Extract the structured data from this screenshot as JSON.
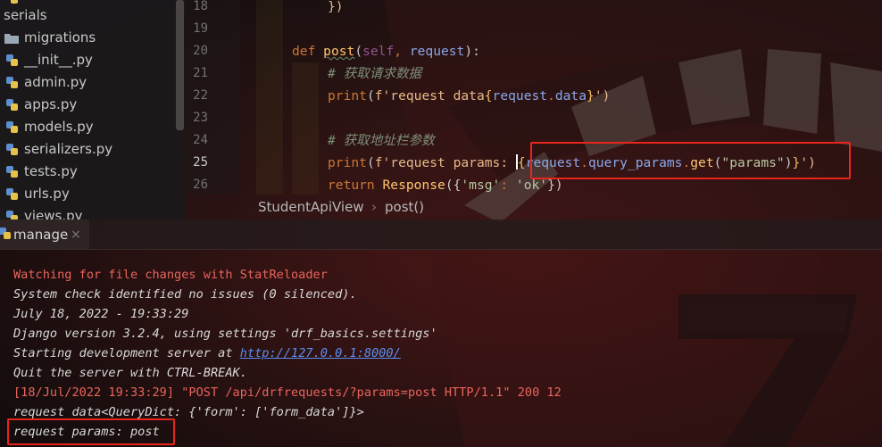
{
  "project_tree": {
    "items": [
      {
        "label": "",
        "kind": "python"
      },
      {
        "label": "serials",
        "kind": "package"
      },
      {
        "label": "migrations",
        "kind": "folder"
      },
      {
        "label": "__init__.py",
        "kind": "python"
      },
      {
        "label": "admin.py",
        "kind": "python"
      },
      {
        "label": "apps.py",
        "kind": "python"
      },
      {
        "label": "models.py",
        "kind": "python"
      },
      {
        "label": "serializers.py",
        "kind": "python"
      },
      {
        "label": "tests.py",
        "kind": "python"
      },
      {
        "label": "urls.py",
        "kind": "python"
      },
      {
        "label": "views.py",
        "kind": "python"
      }
    ]
  },
  "editor": {
    "line_numbers": [
      "18",
      "19",
      "20",
      "21",
      "22",
      "23",
      "24",
      "25",
      "26"
    ],
    "code": {
      "l18_close": "})",
      "l20_def": "def",
      "l20_name": "post",
      "l20_open": "(",
      "l20_self": "self",
      "l20_comma": ", ",
      "l20_request": "request",
      "l20_close": "):",
      "l21_comment": "# 获取请求数据",
      "l22_print": "print",
      "l22_open": "(",
      "l22_fstr": "f'request data",
      "l22_brace_open": "{",
      "l22_request": "request",
      "l22_dot": ".",
      "l22_data": "data",
      "l22_brace_close": "}",
      "l22_end": "')",
      "l24_comment": "# 获取地址栏参数",
      "l25_print": "print",
      "l25_open": "(",
      "l25_fstr": "f'request params:",
      "l25_request": "request",
      "l25_dot1": ".",
      "l25_query": "query_params",
      "l25_dot2": ".",
      "l25_get": "get",
      "l25_paren": "(",
      "l25_key": "\"params\"",
      "l25_paren_close": ")",
      "l25_brace_close": "}",
      "l25_end": "')",
      "l26_return": "return",
      "l26_response": "Response",
      "l26_open": "({",
      "l26_key": "'msg'",
      "l26_colon": ": ",
      "l26_val": "'ok'",
      "l26_close": "})"
    },
    "caret_line": "25"
  },
  "breadcrumb": {
    "items": [
      "StudentApiView",
      "post()"
    ],
    "separator": "›"
  },
  "run_panel": {
    "tab_label": "manage",
    "close_glyph": "×"
  },
  "console": {
    "lines": [
      {
        "text": "Watching for file changes with StatReloader",
        "style": "red"
      },
      {
        "text": "System check identified no issues (0 silenced).",
        "style": "italic"
      },
      {
        "text": "July 18, 2022 - 19:33:29",
        "style": "italic"
      },
      {
        "text": "Django version 3.2.4, using settings 'drf_basics.settings'",
        "style": "italic"
      },
      {
        "text": "Starting development server at ",
        "style": "italic"
      },
      {
        "text": "Quit the server with CTRL-BREAK.",
        "style": "italic"
      },
      {
        "text": "[18/Jul/2022 19:33:29] \"POST /api/drfrequests/?params=post HTTP/1.1\" 200 12",
        "style": "red"
      },
      {
        "text": "request data<QueryDict: {'form': ['form_data']}>",
        "style": "italic"
      },
      {
        "text": "request params: post",
        "style": "italic"
      }
    ],
    "server_link": "http://127.0.0.1:8000/"
  },
  "colors": {
    "highlight_box": "#e8251c",
    "keyword": "#cc7832",
    "function": "#ffc66d",
    "string": "#6a8759",
    "console_red": "#e9645c",
    "link": "#5e8ef0"
  }
}
